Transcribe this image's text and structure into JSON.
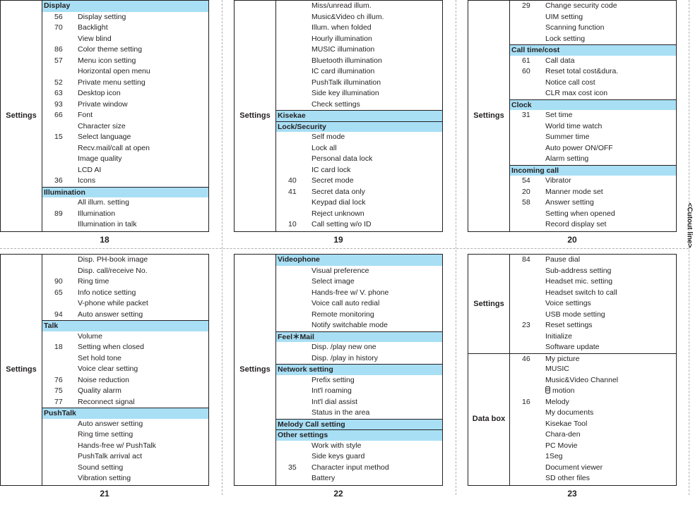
{
  "cutout_label": "<Cutout line>",
  "panels": [
    {
      "page": "18",
      "categories": [
        {
          "name": "Settings",
          "blocks": [
            {
              "header": "Display",
              "items": [
                {
                  "num": "56",
                  "label": "Display setting"
                },
                {
                  "num": "70",
                  "label": "Backlight"
                },
                {
                  "num": "",
                  "label": "View blind"
                },
                {
                  "num": "86",
                  "label": "Color theme setting"
                },
                {
                  "num": "57",
                  "label": "Menu icon setting"
                },
                {
                  "num": "",
                  "label": "Horizontal open menu"
                },
                {
                  "num": "52",
                  "label": "Private menu setting"
                },
                {
                  "num": "63",
                  "label": "Desktop icon"
                },
                {
                  "num": "93",
                  "label": "Private window"
                },
                {
                  "num": "66",
                  "label": "Font"
                },
                {
                  "num": "",
                  "label": "Character size"
                },
                {
                  "num": "15",
                  "label": "Select language"
                },
                {
                  "num": "",
                  "label": "Recv.mail/call at open"
                },
                {
                  "num": "",
                  "label": "Image quality"
                },
                {
                  "num": "",
                  "label": "LCD AI"
                },
                {
                  "num": "36",
                  "label": "Icons"
                }
              ]
            },
            {
              "header": "Illumination",
              "items": [
                {
                  "num": "",
                  "label": "All illum. setting"
                },
                {
                  "num": "89",
                  "label": "Illumination"
                },
                {
                  "num": "",
                  "label": "Illumination in talk"
                }
              ]
            }
          ]
        }
      ]
    },
    {
      "page": "19",
      "categories": [
        {
          "name": "Settings",
          "blocks": [
            {
              "header": "",
              "items": [
                {
                  "num": "",
                  "label": "Miss/unread illum."
                },
                {
                  "num": "",
                  "label": "Music&Video ch illum."
                },
                {
                  "num": "",
                  "label": "Illum. when folded"
                },
                {
                  "num": "",
                  "label": "Hourly illumination"
                },
                {
                  "num": "",
                  "label": "MUSIC illumination"
                },
                {
                  "num": "",
                  "label": "Bluetooth illumination"
                },
                {
                  "num": "",
                  "label": "IC card illumination"
                },
                {
                  "num": "",
                  "label": "PushTalk illumination"
                },
                {
                  "num": "",
                  "label": "Side key illumination"
                },
                {
                  "num": "",
                  "label": "Check settings"
                }
              ]
            },
            {
              "header": "Kisekae",
              "items": []
            },
            {
              "header": "Lock/Security",
              "items": [
                {
                  "num": "",
                  "label": "Self mode"
                },
                {
                  "num": "",
                  "label": "Lock all"
                },
                {
                  "num": "",
                  "label": "Personal data lock"
                },
                {
                  "num": "",
                  "label": "IC card lock"
                },
                {
                  "num": "40",
                  "label": "Secret mode"
                },
                {
                  "num": "41",
                  "label": "Secret data only"
                },
                {
                  "num": "",
                  "label": "Keypad dial lock"
                },
                {
                  "num": "",
                  "label": "Reject unknown"
                },
                {
                  "num": "10",
                  "label": "Call setting w/o ID"
                }
              ]
            }
          ]
        }
      ]
    },
    {
      "page": "20",
      "categories": [
        {
          "name": "Settings",
          "blocks": [
            {
              "header": "",
              "items": [
                {
                  "num": "29",
                  "label": "Change security code"
                },
                {
                  "num": "",
                  "label": "UIM setting"
                },
                {
                  "num": "",
                  "label": "Scanning function"
                },
                {
                  "num": "",
                  "label": "Lock setting"
                }
              ]
            },
            {
              "header": "Call time/cost",
              "items": [
                {
                  "num": "61",
                  "label": "Call data"
                },
                {
                  "num": "60",
                  "label": "Reset total cost&dura."
                },
                {
                  "num": "",
                  "label": "Notice call cost"
                },
                {
                  "num": "",
                  "label": "CLR max cost icon"
                }
              ]
            },
            {
              "header": "Clock",
              "items": [
                {
                  "num": "31",
                  "label": "Set time"
                },
                {
                  "num": "",
                  "label": "World time watch"
                },
                {
                  "num": "",
                  "label": "Summer time"
                },
                {
                  "num": "",
                  "label": "Auto power ON/OFF"
                },
                {
                  "num": "",
                  "label": "Alarm setting"
                }
              ]
            },
            {
              "header": "Incoming call",
              "items": [
                {
                  "num": "54",
                  "label": "Vibrator"
                },
                {
                  "num": "20",
                  "label": "Manner mode set"
                },
                {
                  "num": "58",
                  "label": "Answer setting"
                },
                {
                  "num": "",
                  "label": "Setting when opened"
                },
                {
                  "num": "",
                  "label": "Record display set"
                }
              ]
            }
          ]
        }
      ]
    },
    {
      "page": "21",
      "categories": [
        {
          "name": "Settings",
          "blocks": [
            {
              "header": "",
              "items": [
                {
                  "num": "",
                  "label": "Disp. PH-book image"
                },
                {
                  "num": "",
                  "label": "Disp. call/receive No."
                },
                {
                  "num": "90",
                  "label": "Ring time"
                },
                {
                  "num": "65",
                  "label": "Info notice setting"
                },
                {
                  "num": "",
                  "label": "V-phone while packet"
                },
                {
                  "num": "94",
                  "label": "Auto answer setting"
                }
              ]
            },
            {
              "header": "Talk",
              "items": [
                {
                  "num": "",
                  "label": "Volume"
                },
                {
                  "num": "18",
                  "label": "Setting when closed"
                },
                {
                  "num": "",
                  "label": "Set hold tone"
                },
                {
                  "num": "",
                  "label": "Voice clear setting"
                },
                {
                  "num": "76",
                  "label": "Noise reduction"
                },
                {
                  "num": "75",
                  "label": "Quality alarm"
                },
                {
                  "num": "77",
                  "label": "Reconnect signal"
                }
              ]
            },
            {
              "header": "PushTalk",
              "items": [
                {
                  "num": "",
                  "label": "Auto answer setting"
                },
                {
                  "num": "",
                  "label": "Ring time setting"
                },
                {
                  "num": "",
                  "label": "Hands-free w/ PushTalk"
                },
                {
                  "num": "",
                  "label": "PushTalk arrival act"
                },
                {
                  "num": "",
                  "label": "Sound setting"
                },
                {
                  "num": "",
                  "label": "Vibration setting"
                }
              ]
            }
          ]
        }
      ]
    },
    {
      "page": "22",
      "categories": [
        {
          "name": "Settings",
          "blocks": [
            {
              "header": "Videophone",
              "items": [
                {
                  "num": "",
                  "label": "Visual preference"
                },
                {
                  "num": "",
                  "label": "Select image"
                },
                {
                  "num": "",
                  "label": "Hands-free w/ V. phone"
                },
                {
                  "num": "",
                  "label": "Voice call auto redial"
                },
                {
                  "num": "",
                  "label": "Remote monitoring"
                },
                {
                  "num": "",
                  "label": "Notify switchable mode"
                }
              ]
            },
            {
              "header": "Feel＊Mail",
              "items": [
                {
                  "num": "",
                  "label": "Disp. /play new one"
                },
                {
                  "num": "",
                  "label": "Disp. /play in history"
                }
              ]
            },
            {
              "header": "Network setting",
              "items": [
                {
                  "num": "",
                  "label": "Prefix setting"
                },
                {
                  "num": "",
                  "label": "Int'l roaming"
                },
                {
                  "num": "",
                  "label": "Int'l dial assist"
                },
                {
                  "num": "",
                  "label": "Status in the area"
                }
              ]
            },
            {
              "header": "Melody Call setting",
              "items": []
            },
            {
              "header": "Other settings",
              "items": [
                {
                  "num": "",
                  "label": "Work with style"
                },
                {
                  "num": "",
                  "label": "Side keys guard"
                },
                {
                  "num": "35",
                  "label": "Character input method"
                },
                {
                  "num": "",
                  "label": "Battery"
                }
              ]
            }
          ]
        }
      ]
    },
    {
      "page": "23",
      "categories": [
        {
          "name": "Settings",
          "blocks": [
            {
              "header": "",
              "items": [
                {
                  "num": "84",
                  "label": "Pause dial"
                },
                {
                  "num": "",
                  "label": "Sub-address setting"
                },
                {
                  "num": "",
                  "label": "Headset mic. setting"
                },
                {
                  "num": "",
                  "label": "Headset switch to call"
                },
                {
                  "num": "",
                  "label": "Voice settings"
                },
                {
                  "num": "",
                  "label": "USB mode setting"
                },
                {
                  "num": "23",
                  "label": "Reset settings"
                },
                {
                  "num": "",
                  "label": "Initialize"
                },
                {
                  "num": "",
                  "label": "Software update"
                }
              ]
            }
          ]
        },
        {
          "name": "Data box",
          "blocks": [
            {
              "header": "",
              "items": [
                {
                  "num": "46",
                  "label": "My picture"
                },
                {
                  "num": "",
                  "label": "MUSIC"
                },
                {
                  "num": "",
                  "label": "Music&Video Channel"
                },
                {
                  "num": "",
                  "label": "motion",
                  "icon": "i-appli-icon"
                },
                {
                  "num": "16",
                  "label": "Melody"
                },
                {
                  "num": "",
                  "label": "My documents"
                },
                {
                  "num": "",
                  "label": "Kisekae Tool"
                },
                {
                  "num": "",
                  "label": "Chara-den"
                },
                {
                  "num": "",
                  "label": "PC Movie"
                },
                {
                  "num": "",
                  "label": "1Seg"
                },
                {
                  "num": "",
                  "label": "Document viewer"
                },
                {
                  "num": "",
                  "label": "SD other files"
                }
              ]
            }
          ]
        }
      ]
    }
  ]
}
